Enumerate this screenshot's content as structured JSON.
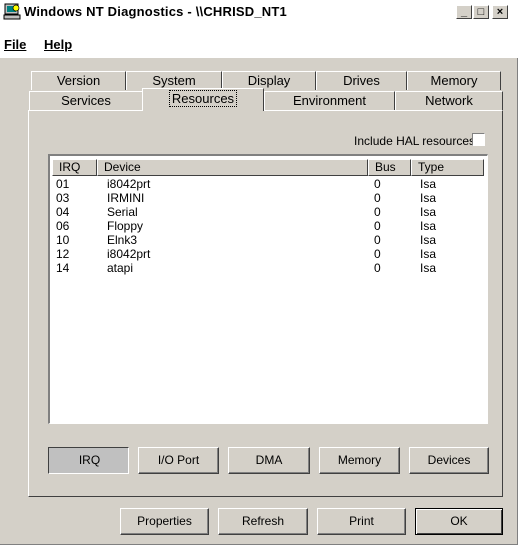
{
  "window": {
    "title": "Windows NT Diagnostics - \\\\CHRISD_NT1",
    "minimize_glyph": "_",
    "maximize_glyph": "□",
    "close_glyph": "×",
    "icon": "computer-icon"
  },
  "menu": {
    "file": "File",
    "help": "Help"
  },
  "tabs": {
    "back_row": [
      "Version",
      "System",
      "Display",
      "Drives",
      "Memory"
    ],
    "front_row": [
      "Services",
      "Resources",
      "Environment",
      "Network"
    ],
    "active": "Resources"
  },
  "hal": {
    "label": "Include HAL resources",
    "checked": false
  },
  "table": {
    "headers": [
      "IRQ",
      "Device",
      "Bus",
      "Type"
    ],
    "rows": [
      {
        "irq": "01",
        "device": "i8042prt",
        "bus": "0",
        "type": "Isa"
      },
      {
        "irq": "03",
        "device": "IRMINI",
        "bus": "0",
        "type": "Isa"
      },
      {
        "irq": "04",
        "device": "Serial",
        "bus": "0",
        "type": "Isa"
      },
      {
        "irq": "06",
        "device": "Floppy",
        "bus": "0",
        "type": "Isa"
      },
      {
        "irq": "10",
        "device": "Elnk3",
        "bus": "0",
        "type": "Isa"
      },
      {
        "irq": "12",
        "device": "i8042prt",
        "bus": "0",
        "type": "Isa"
      },
      {
        "irq": "14",
        "device": "atapi",
        "bus": "0",
        "type": "Isa"
      }
    ]
  },
  "view_buttons": [
    "IRQ",
    "I/O Port",
    "DMA",
    "Memory",
    "Devices"
  ],
  "bottom_buttons": [
    "Properties",
    "Refresh",
    "Print",
    "OK"
  ],
  "colors": {
    "face": "#d4d0c8",
    "titlebar": "#ffffff"
  }
}
